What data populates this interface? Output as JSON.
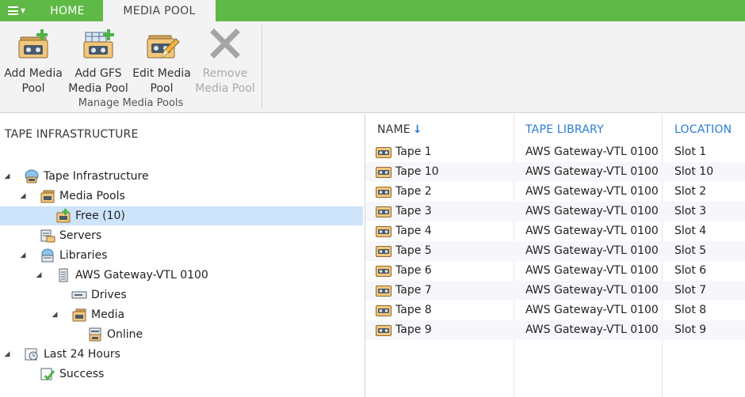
{
  "tabs": {
    "home": "HOME",
    "media_pool": "MEDIA POOL"
  },
  "ribbon": {
    "buttons": [
      {
        "label1": "Add Media",
        "label2": "Pool",
        "enabled": true
      },
      {
        "label1": "Add GFS",
        "label2": "Media Pool",
        "enabled": true
      },
      {
        "label1": "Edit Media",
        "label2": "Pool",
        "enabled": true
      },
      {
        "label1": "Remove",
        "label2": "Media Pool",
        "enabled": false
      }
    ],
    "group_label": "Manage Media Pools"
  },
  "left_panel": {
    "title": "TAPE INFRASTRUCTURE",
    "tree": [
      {
        "label": "Tape Infrastructure",
        "expanded": true,
        "icon": "tape-infrastructure-icon"
      },
      {
        "label": "Media Pools",
        "expanded": true,
        "icon": "media-pools-icon"
      },
      {
        "label": "Free (10)",
        "selected": true,
        "icon": "media-pool-free-icon"
      },
      {
        "label": "Servers",
        "icon": "tape-server-icon"
      },
      {
        "label": "Libraries",
        "expanded": true,
        "icon": "libraries-icon"
      },
      {
        "label": "AWS Gateway-VTL 0100",
        "expanded": true,
        "icon": "tape-library-icon"
      },
      {
        "label": "Drives",
        "icon": "drives-icon"
      },
      {
        "label": "Media",
        "expanded": true,
        "icon": "media-icon"
      },
      {
        "label": "Online",
        "icon": "online-media-icon"
      },
      {
        "label": "Last 24 Hours",
        "expanded": true,
        "icon": "last-24-hours-icon"
      },
      {
        "label": "Success",
        "icon": "success-icon"
      }
    ]
  },
  "grid": {
    "columns": {
      "name": "NAME",
      "library": "TAPE LIBRARY",
      "location": "LOCATION"
    },
    "sort_indicator": "↓",
    "rows": [
      {
        "name": "Tape 1",
        "library": "AWS Gateway-VTL 0100",
        "location": "Slot 1"
      },
      {
        "name": "Tape 10",
        "library": "AWS Gateway-VTL 0100",
        "location": "Slot 10"
      },
      {
        "name": "Tape 2",
        "library": "AWS Gateway-VTL 0100",
        "location": "Slot 2"
      },
      {
        "name": "Tape 3",
        "library": "AWS Gateway-VTL 0100",
        "location": "Slot 3"
      },
      {
        "name": "Tape 4",
        "library": "AWS Gateway-VTL 0100",
        "location": "Slot 4"
      },
      {
        "name": "Tape 5",
        "library": "AWS Gateway-VTL 0100",
        "location": "Slot 5"
      },
      {
        "name": "Tape 6",
        "library": "AWS Gateway-VTL 0100",
        "location": "Slot 6"
      },
      {
        "name": "Tape 7",
        "library": "AWS Gateway-VTL 0100",
        "location": "Slot 7"
      },
      {
        "name": "Tape 8",
        "library": "AWS Gateway-VTL 0100",
        "location": "Slot 8"
      },
      {
        "name": "Tape 9",
        "library": "AWS Gateway-VTL 0100",
        "location": "Slot 9"
      }
    ]
  },
  "colors": {
    "accent_green": "#5fb946",
    "header_blue": "#2a7bd5",
    "selection": "#cde4fb"
  }
}
